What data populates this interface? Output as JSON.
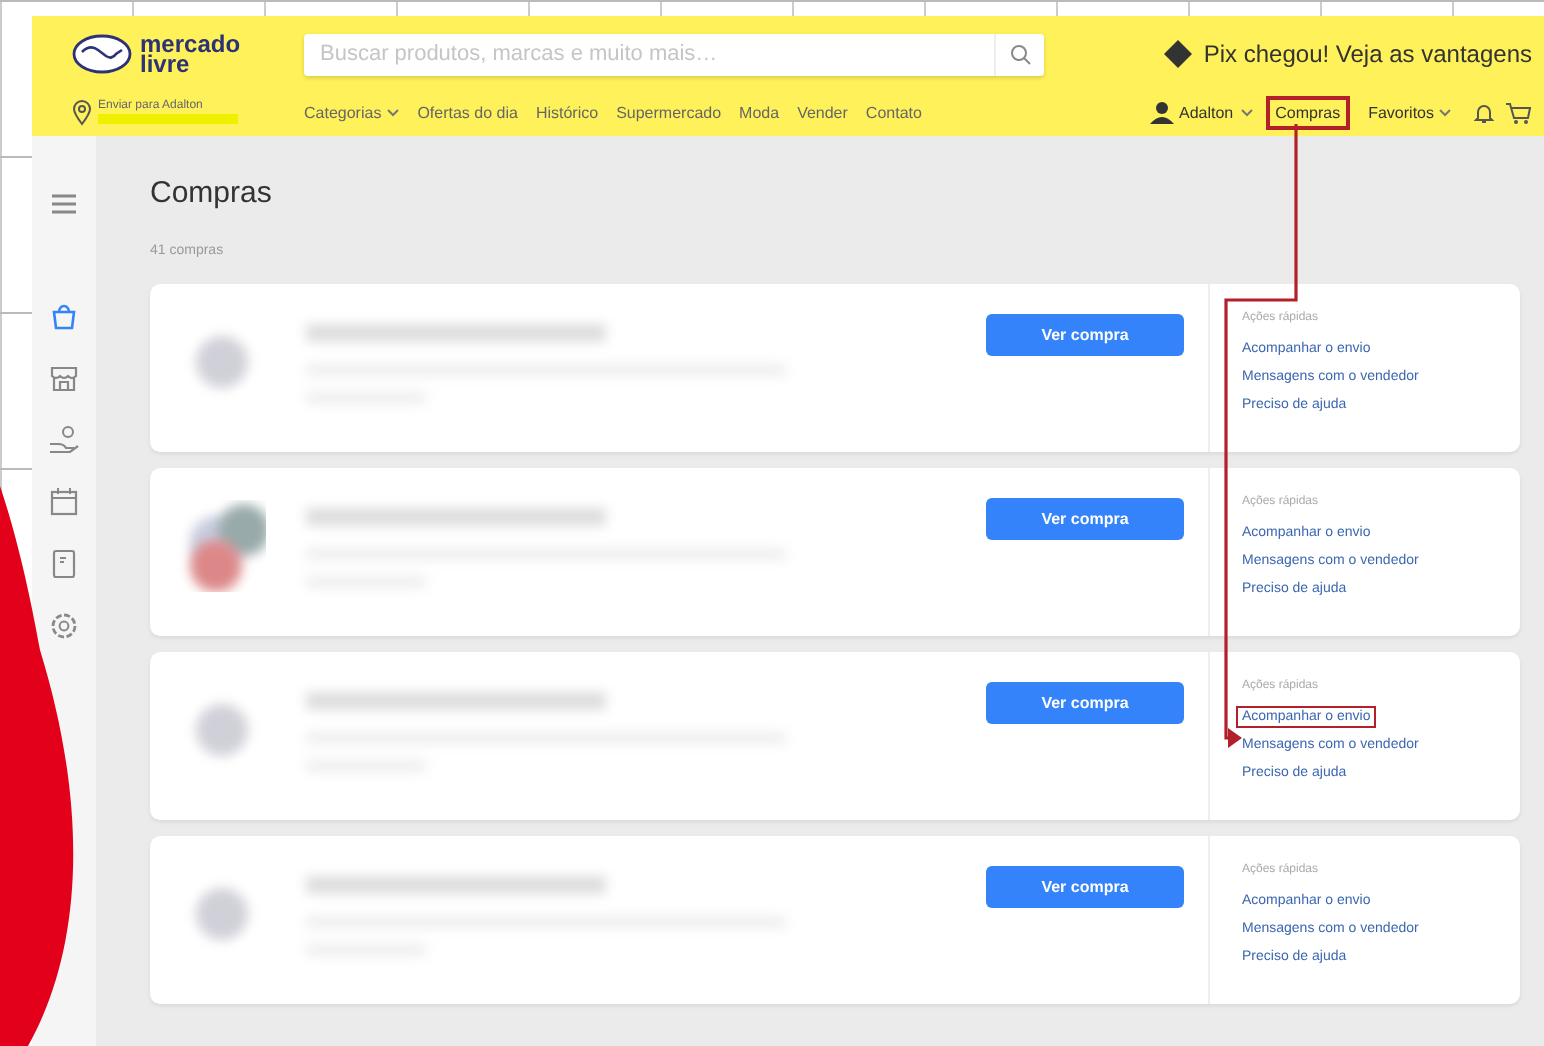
{
  "header": {
    "logo_lines": [
      "mercado",
      "livre"
    ],
    "search": {
      "placeholder": "Buscar produtos, marcas e muito mais…"
    },
    "promo": "Pix chegou! Veja as vantagens",
    "location": "Enviar para Adalton",
    "nav": [
      {
        "label": "Categorias",
        "dropdown": true
      },
      {
        "label": "Ofertas do dia",
        "dropdown": false
      },
      {
        "label": "Histórico",
        "dropdown": false
      },
      {
        "label": "Supermercado",
        "dropdown": false
      },
      {
        "label": "Moda",
        "dropdown": false
      },
      {
        "label": "Vender",
        "dropdown": false
      },
      {
        "label": "Contato",
        "dropdown": false
      }
    ],
    "user": "Adalton",
    "account_links": [
      {
        "label": "Compras",
        "dropdown": false,
        "annotated": true
      },
      {
        "label": "Favoritos",
        "dropdown": true,
        "annotated": false
      }
    ]
  },
  "sidebar": {
    "items": [
      {
        "kind": "menu",
        "selected": false
      },
      {
        "kind": "bag",
        "selected": true
      },
      {
        "kind": "store",
        "selected": false
      },
      {
        "kind": "hand",
        "selected": false
      },
      {
        "kind": "calendar",
        "selected": false
      },
      {
        "kind": "receipt",
        "selected": false
      },
      {
        "kind": "settings",
        "selected": false
      }
    ]
  },
  "page": {
    "title": "Compras",
    "count": "41 compras"
  },
  "purchases": [
    {
      "kind": "single",
      "button": "Ver compra",
      "actions_title": "Ações rápidas",
      "actions": [
        {
          "label": "Acompanhar o envio",
          "annotated": false
        },
        {
          "label": "Mensagens com o vendedor",
          "annotated": false
        },
        {
          "label": "Preciso de ajuda",
          "annotated": false
        }
      ]
    },
    {
      "kind": "group",
      "button": "Ver compra",
      "actions_title": "Ações rápidas",
      "actions": [
        {
          "label": "Acompanhar o envio",
          "annotated": false
        },
        {
          "label": "Mensagens com o vendedor",
          "annotated": false
        },
        {
          "label": "Preciso de ajuda",
          "annotated": false
        }
      ]
    },
    {
      "kind": "single",
      "button": "Ver compra",
      "actions_title": "Ações rápidas",
      "actions": [
        {
          "label": "Acompanhar o envio",
          "annotated": true
        },
        {
          "label": "Mensagens com o vendedor",
          "annotated": false
        },
        {
          "label": "Preciso de ajuda",
          "annotated": false
        }
      ]
    },
    {
      "kind": "single",
      "button": "Ver compra",
      "actions_title": "Ações rápidas",
      "actions": [
        {
          "label": "Acompanhar o envio",
          "annotated": false
        },
        {
          "label": "Mensagens com o vendedor",
          "annotated": false
        },
        {
          "label": "Preciso de ajuda",
          "annotated": false
        }
      ]
    }
  ]
}
